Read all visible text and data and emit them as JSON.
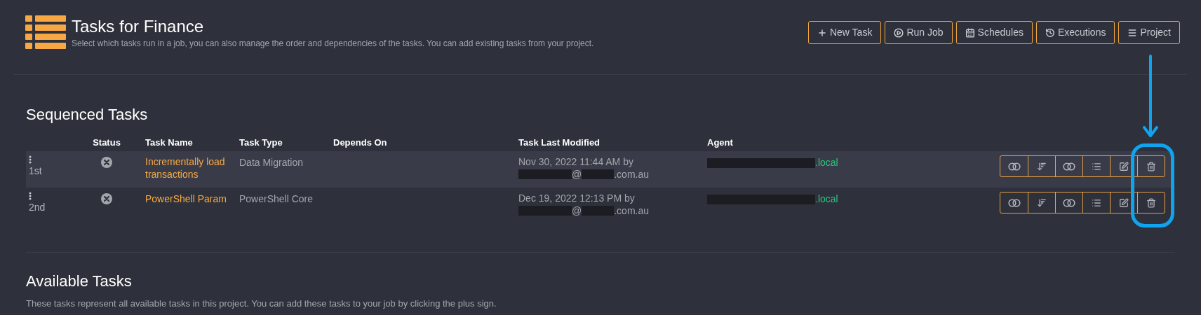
{
  "header": {
    "title": "Tasks for Finance",
    "subtitle": "Select which tasks run in a job, you can also manage the order and dependencies of the tasks. You can add existing tasks from your project."
  },
  "toolbar": [
    {
      "kind": "plus",
      "label": "New Task"
    },
    {
      "kind": "play",
      "label": "Run Job"
    },
    {
      "kind": "calendar",
      "label": "Schedules"
    },
    {
      "kind": "history",
      "label": "Executions"
    },
    {
      "kind": "menu",
      "label": "Project"
    }
  ],
  "sequenced": {
    "heading": "Sequenced Tasks",
    "columns": [
      "Status",
      "Task Name",
      "Task Type",
      "Depends On",
      "Task Last Modified",
      "Agent"
    ],
    "rows": [
      {
        "order": "1st",
        "failed": true,
        "name": "Incrementally load transactions",
        "type": "Data Migration",
        "modified": "Nov 30, 2022 11:44 AM by",
        "email_at": "@",
        "email_domain": ".com.au",
        "agent_suffix": ".local"
      },
      {
        "order": "2nd",
        "failed": true,
        "name": "PowerShell Param",
        "type": "PowerShell Core",
        "modified": "Dec 19, 2022 12:13 PM by",
        "email_at": "@",
        "email_domain": ".com.au",
        "agent_suffix": ".local"
      }
    ],
    "actions": [
      {
        "kind": "toggle"
      },
      {
        "kind": "sort"
      },
      {
        "kind": "toggle"
      },
      {
        "kind": "list"
      },
      {
        "kind": "edit"
      },
      {
        "kind": "delete"
      }
    ]
  },
  "available": {
    "heading": "Available Tasks",
    "description": "These tasks represent all available tasks in this project. You can add these tasks to your job by clicking the plus sign."
  }
}
